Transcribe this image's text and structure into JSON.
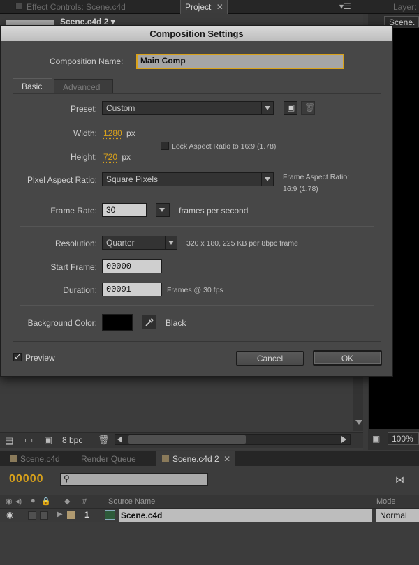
{
  "panels": {
    "tab_effect_controls": "Effect Controls: Scene.c4d",
    "tab_project": "Project",
    "tab_layer": "Layer:",
    "project_item": "Scene.c4d 2 ▾",
    "right_header": "Scene.",
    "bit_depth": "8 bpc",
    "zoom": "100%"
  },
  "timeline": {
    "tabs": [
      "Scene.c4d",
      "Render Queue",
      "Scene.c4d 2"
    ],
    "timecode": "00000",
    "col_number": "#",
    "col_source": "Source Name",
    "col_mode": "Mode",
    "layer_number": "1",
    "layer_name": "Scene.c4d",
    "layer_mode": "Normal"
  },
  "dialog": {
    "title": "Composition Settings",
    "comp_name_label": "Composition Name:",
    "comp_name_value": "Main Comp",
    "tabs": {
      "basic": "Basic",
      "advanced": "Advanced"
    },
    "preset_label": "Preset:",
    "preset_value": "Custom",
    "width_label": "Width:",
    "width_value": "1280",
    "width_unit": "px",
    "height_label": "Height:",
    "height_value": "720",
    "height_unit": "px",
    "lock_aspect_label": "Lock Aspect Ratio to 16:9 (1.78)",
    "pixel_aspect_label": "Pixel Aspect Ratio:",
    "pixel_aspect_value": "Square Pixels",
    "frame_aspect_label": "Frame Aspect Ratio:",
    "frame_aspect_value": "16:9 (1.78)",
    "frame_rate_label": "Frame Rate:",
    "frame_rate_value": "30",
    "frame_rate_unit": "frames per second",
    "resolution_label": "Resolution:",
    "resolution_value": "Quarter",
    "resolution_info": "320 x 180, 225 KB per 8bpc frame",
    "start_frame_label": "Start Frame:",
    "start_frame_value": "00000",
    "duration_label": "Duration:",
    "duration_value": "00091",
    "duration_info": "Frames @ 30 fps",
    "bg_color_label": "Background Color:",
    "bg_color_value": "#000000",
    "bg_color_name": "Black",
    "preview_label": "Preview",
    "preview_checked": true,
    "cancel_label": "Cancel",
    "ok_label": "OK"
  },
  "colors": {
    "accent": "#d9a21b",
    "dialog_bg": "#474747",
    "app_bg": "#3a3a3a"
  },
  "icons": [
    "close-icon",
    "panel-menu-icon",
    "new-folder-icon",
    "composition-icon",
    "trash-icon",
    "search-icon",
    "eye-icon",
    "audio-icon",
    "solo-icon",
    "lock-icon",
    "label-icon",
    "eyedropper-icon",
    "save-preset-icon",
    "delete-preset-icon"
  ]
}
